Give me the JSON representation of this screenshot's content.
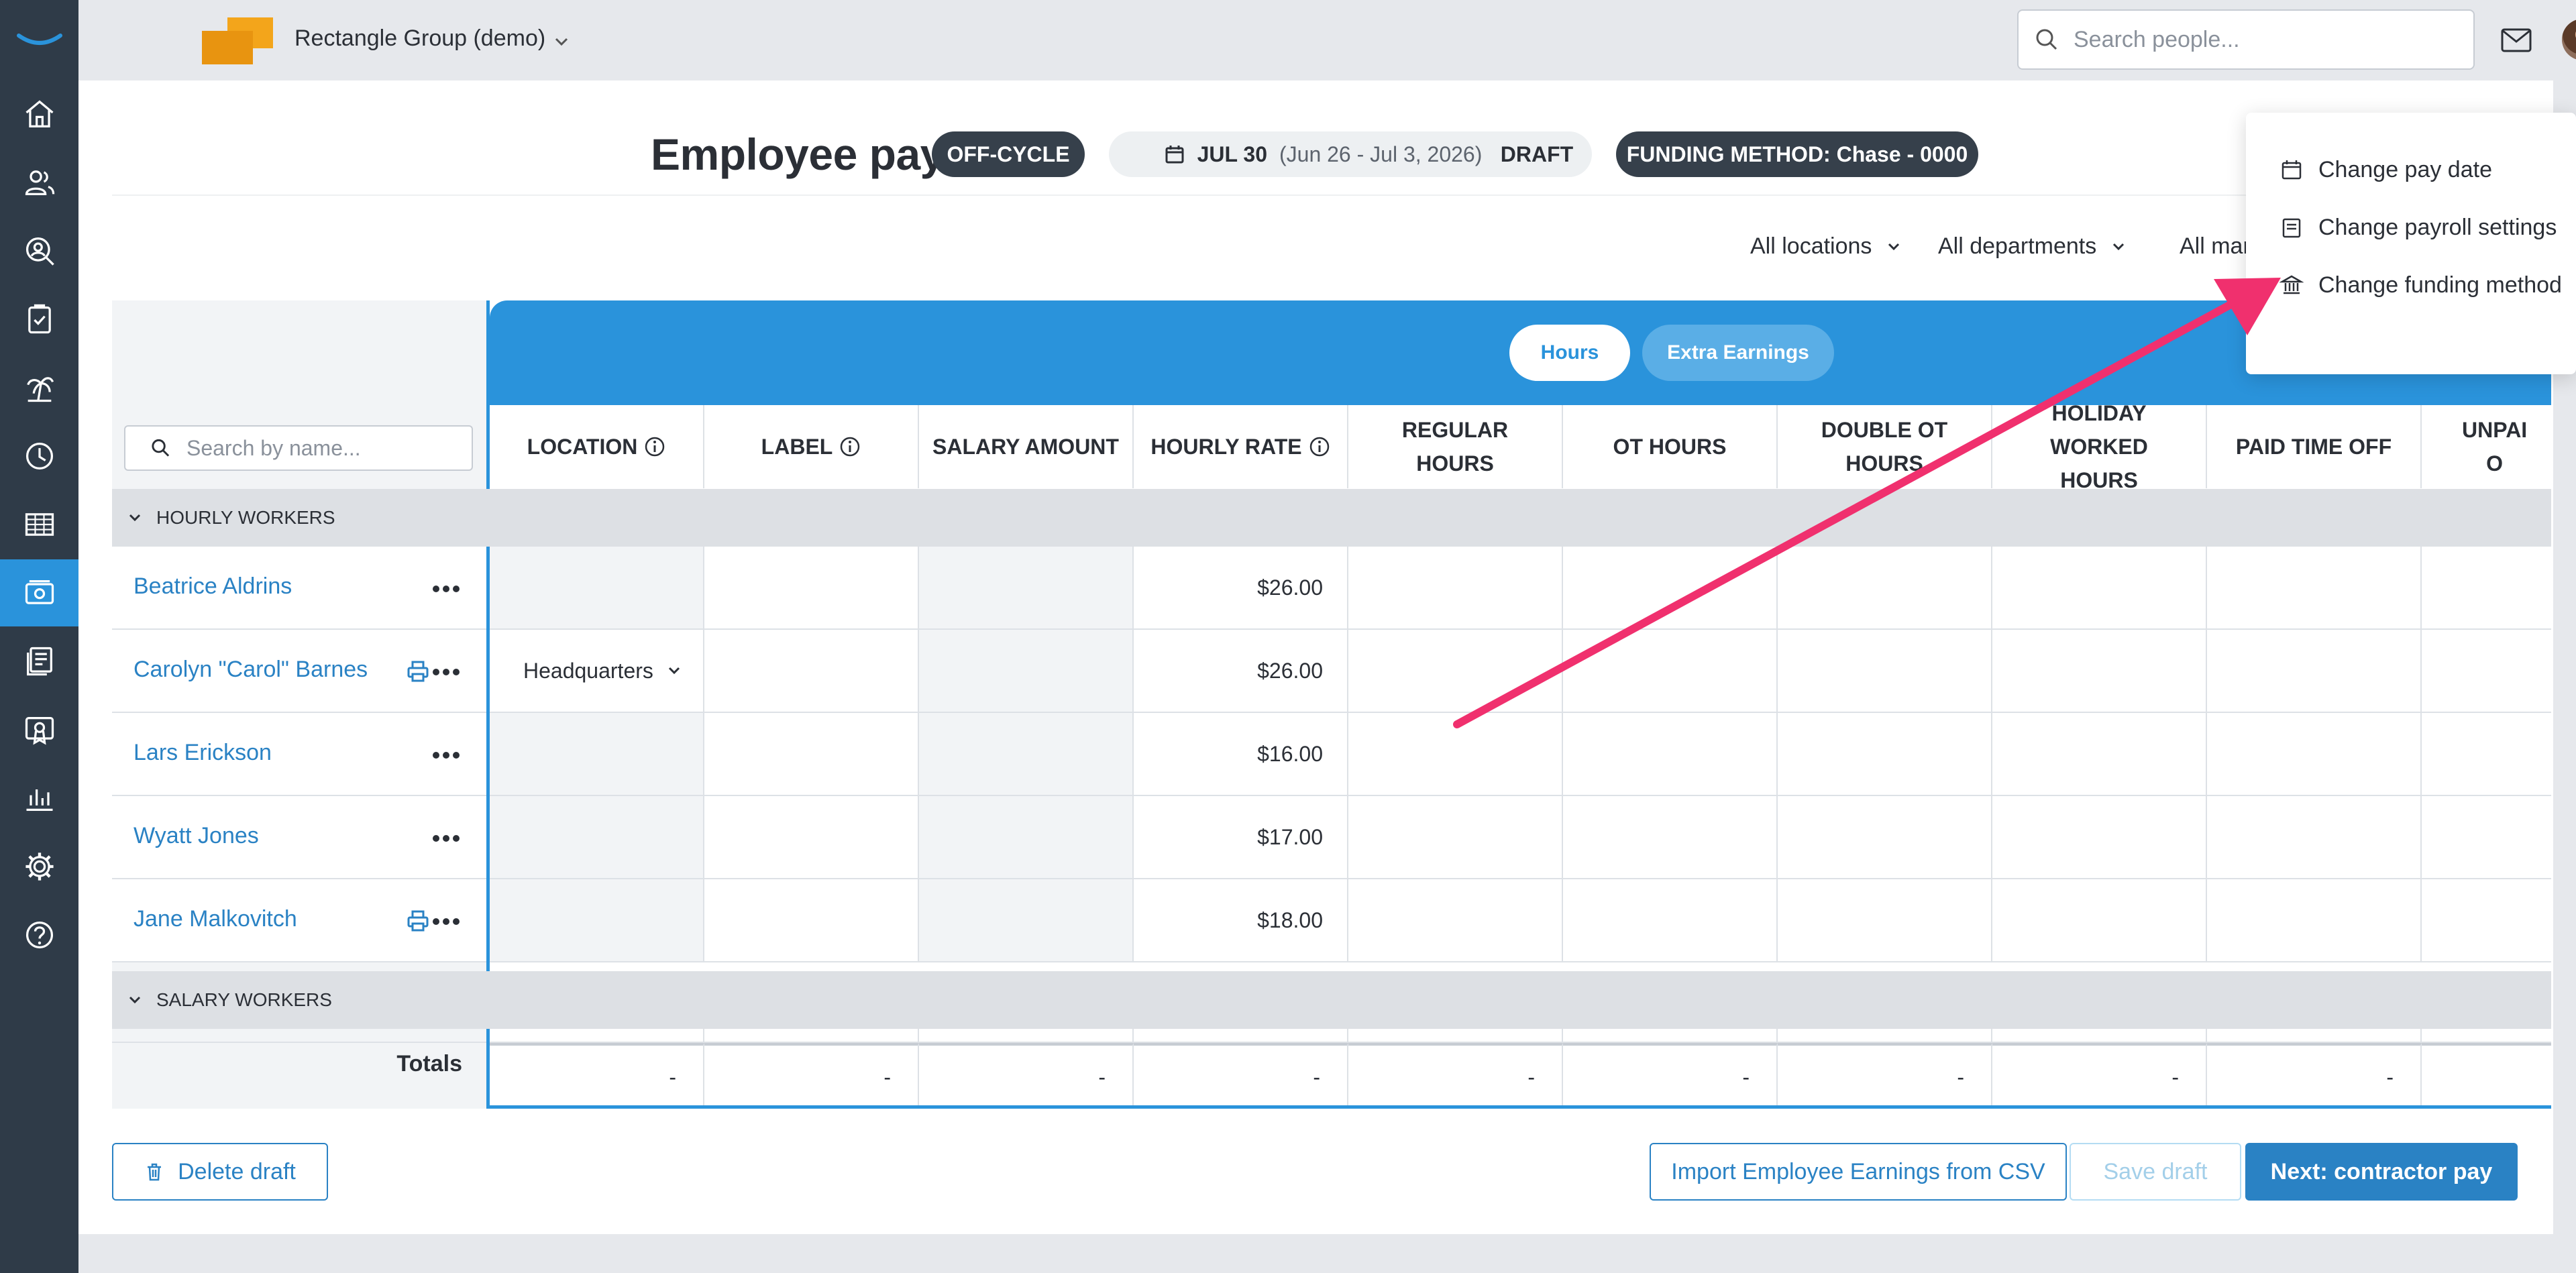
{
  "topbar": {
    "company_name": "Rectangle Group (demo)",
    "search_placeholder": "Search people..."
  },
  "page": {
    "title": "Employee pay",
    "cycle_badge": "OFF-CYCLE",
    "pay_date": "JUL 30",
    "pay_period": "(Jun 26 - Jul 3, 2026)",
    "status_badge": "DRAFT",
    "funding_method": "FUNDING METHOD: Chase - 0000"
  },
  "filters": {
    "locations": "All locations",
    "departments": "All departments",
    "managers": "All mar"
  },
  "menu": {
    "items": [
      {
        "label": "Change pay date",
        "icon": "calendar-icon"
      },
      {
        "label": "Change payroll settings",
        "icon": "settings-doc-icon"
      },
      {
        "label": "Change funding method",
        "icon": "bank-icon"
      }
    ]
  },
  "table": {
    "search_placeholder": "Search by name...",
    "tabs": {
      "hours": "Hours",
      "extra_earnings": "Extra Earnings"
    },
    "columns": {
      "location": "LOCATION",
      "label": "LABEL",
      "salary_amount": "SALARY AMOUNT",
      "hourly_rate": "HOURLY RATE",
      "regular_hours": "REGULAR HOURS",
      "ot_hours": "OT HOURS",
      "double_ot_hours": "DOUBLE OT HOURS",
      "holiday_worked_hours": "HOLIDAY WORKED HOURS",
      "paid_time_off": "PAID TIME OFF",
      "unpaid_partial": "UNPAI O"
    },
    "sections": {
      "hourly": "HOURLY WORKERS",
      "salary": "SALARY WORKERS"
    },
    "rows": [
      {
        "name": "Beatrice Aldrins",
        "location": "",
        "hourly_rate": "$26.00"
      },
      {
        "name": "Carolyn \"Carol\" Barnes",
        "location": "Headquarters",
        "hourly_rate": "$26.00"
      },
      {
        "name": "Lars Erickson",
        "location": "",
        "hourly_rate": "$16.00"
      },
      {
        "name": "Wyatt Jones",
        "location": "",
        "hourly_rate": "$17.00"
      },
      {
        "name": "Jane Malkovitch",
        "location": "",
        "hourly_rate": "$18.00"
      }
    ],
    "totals": {
      "label": "Totals",
      "dash": "-"
    }
  },
  "footer": {
    "delete_draft": "Delete draft",
    "import_csv": "Import Employee Earnings from CSV",
    "save_draft": "Save draft",
    "next": "Next: contractor pay"
  },
  "colors": {
    "accent": "#2a93db",
    "sidebar": "#2f3b48",
    "arrow": "#f0306e"
  }
}
